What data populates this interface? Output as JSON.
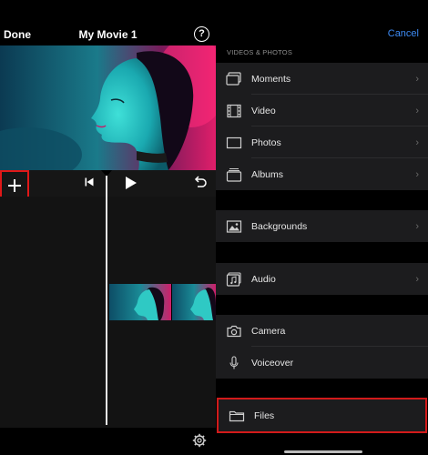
{
  "editor": {
    "done_label": "Done",
    "title": "My Movie 1",
    "help_label": "?"
  },
  "browser": {
    "cancel_label": "Cancel",
    "section_label": "VIDEOS & PHOTOS",
    "media_items": [
      {
        "label": "Moments",
        "icon": "moments-icon"
      },
      {
        "label": "Video",
        "icon": "film-strip-icon"
      },
      {
        "label": "Photos",
        "icon": "photo-frame-icon"
      },
      {
        "label": "Albums",
        "icon": "albums-icon"
      }
    ],
    "backgrounds_label": "Backgrounds",
    "audio_label": "Audio",
    "camera_label": "Camera",
    "voiceover_label": "Voiceover",
    "files_label": "Files"
  },
  "colors": {
    "accent_blue": "#3d8bf5",
    "highlight_red": "#e01818",
    "panel_bg": "#1c1c1e"
  }
}
